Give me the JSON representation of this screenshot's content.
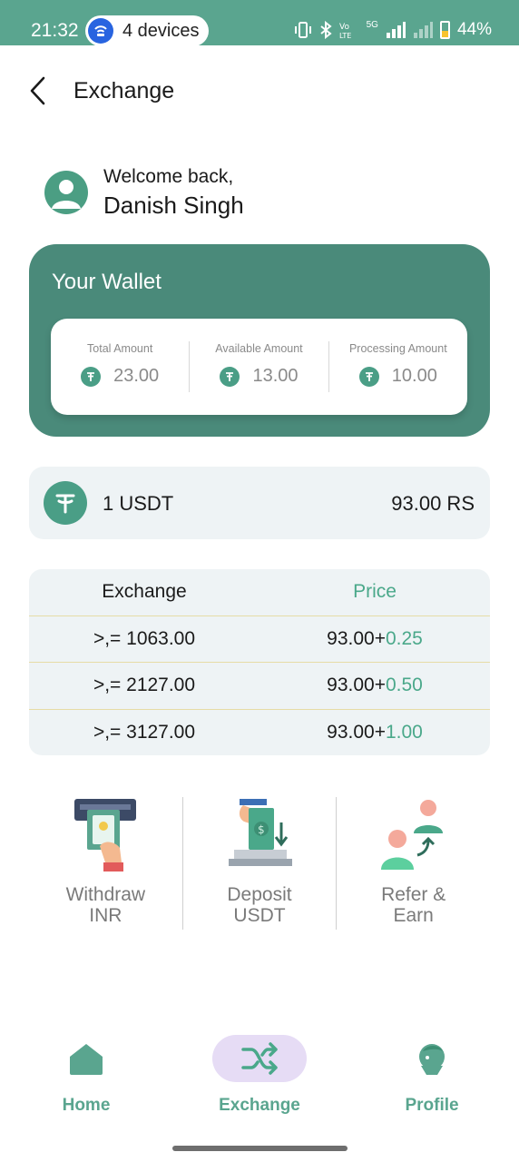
{
  "status_bar": {
    "time": "21:32",
    "hotspot_label": "4 devices",
    "network_label": "5G",
    "battery_percent": "44%"
  },
  "header": {
    "title": "Exchange"
  },
  "welcome": {
    "greeting": "Welcome back,",
    "name": "Danish Singh"
  },
  "wallet": {
    "title": "Your Wallet",
    "columns": [
      {
        "label": "Total Amount",
        "value": "23.00"
      },
      {
        "label": "Available Amount",
        "value": "13.00"
      },
      {
        "label": "Processing Amount",
        "value": "10.00"
      }
    ]
  },
  "rate": {
    "left": "1 USDT",
    "right": "93.00 RS"
  },
  "exchange_table": {
    "headers": {
      "exchange": "Exchange",
      "price": "Price"
    },
    "rows": [
      {
        "exchange": ">,= 1063.00",
        "base": "93.00+",
        "bonus": "0.25"
      },
      {
        "exchange": ">,= 2127.00",
        "base": "93.00+",
        "bonus": "0.50"
      },
      {
        "exchange": ">,= 3127.00",
        "base": "93.00+",
        "bonus": "1.00"
      }
    ]
  },
  "actions": [
    {
      "line1": "Withdraw",
      "line2": "INR",
      "icon": "withdraw-atm-icon"
    },
    {
      "line1": "Deposit",
      "line2": "USDT",
      "icon": "deposit-cash-icon"
    },
    {
      "line1": "Refer &",
      "line2": "Earn",
      "icon": "refer-people-icon"
    }
  ],
  "bottom_nav": [
    {
      "label": "Home",
      "icon": "home-icon",
      "active": false
    },
    {
      "label": "Exchange",
      "icon": "shuffle-icon",
      "active": true
    },
    {
      "label": "Profile",
      "icon": "profile-icon",
      "active": false
    }
  ],
  "colors": {
    "brand_green": "#4a8a7a",
    "accent_green": "#4aa88a",
    "active_nav_bg": "#e6dcf5"
  }
}
